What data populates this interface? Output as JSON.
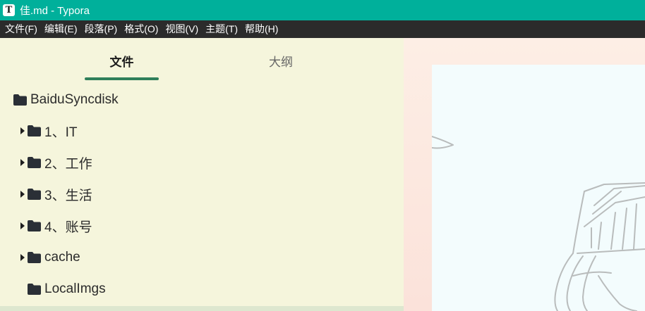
{
  "window": {
    "logo_letter": "T",
    "title": "佳.md - Typora"
  },
  "menu": [
    "文件(F)",
    "编辑(E)",
    "段落(P)",
    "格式(O)",
    "视图(V)",
    "主题(T)",
    "帮助(H)"
  ],
  "sidebar": {
    "tabs": {
      "files": "文件",
      "outline": "大纲"
    },
    "tree": {
      "root": "BaiduSyncdisk",
      "items": [
        {
          "label": "1、IT",
          "expandable": true
        },
        {
          "label": "2、工作",
          "expandable": true
        },
        {
          "label": "3、生活",
          "expandable": true
        },
        {
          "label": "4、账号",
          "expandable": true
        },
        {
          "label": "cache",
          "expandable": true
        },
        {
          "label": "LocalImgs",
          "expandable": false
        }
      ]
    }
  },
  "colors": {
    "titlebar": "#00b09b",
    "menubar": "#2b2b2b",
    "sidebar_bg": "#f5f5dc",
    "tab_underline": "#2f7f5a",
    "editor_page": "#f3fcfd"
  }
}
